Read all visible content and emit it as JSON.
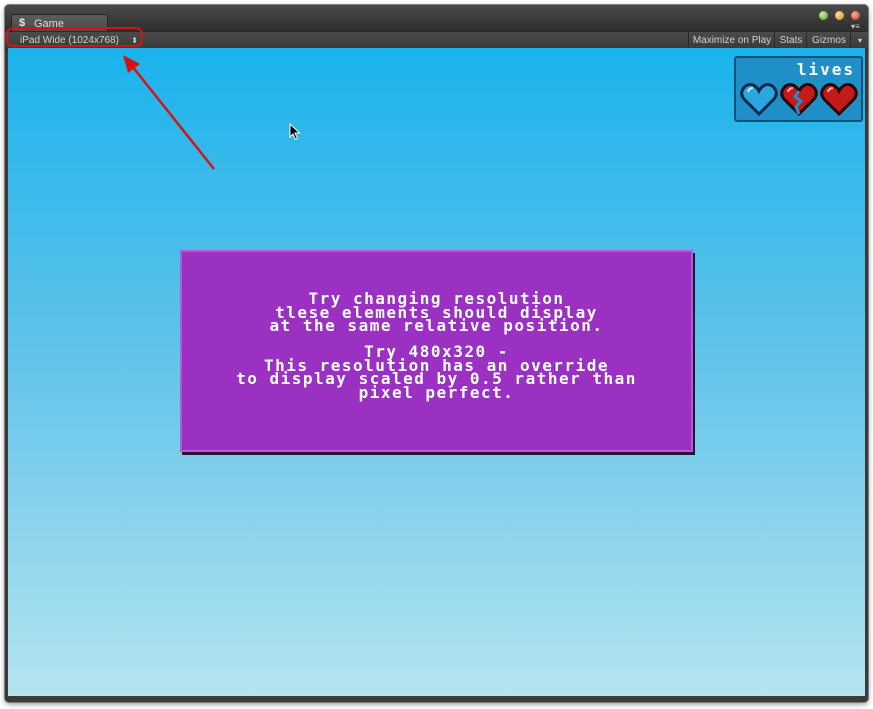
{
  "window": {
    "tab_title": "Game",
    "tab_icon": "unity-logo-icon",
    "traffic_lights": [
      "green",
      "orange",
      "red"
    ]
  },
  "toolbar": {
    "resolution_selected": "iPad Wide (1024x768)",
    "resolution_arrows": "⬍",
    "maximize_label": "Maximize on Play",
    "stats_label": "Stats",
    "gizmos_label": "Gizmos",
    "gizmos_arrow": "▾"
  },
  "game": {
    "lives": {
      "label": "lives",
      "hearts": [
        "empty",
        "broken",
        "full"
      ]
    },
    "message": {
      "block1": [
        "Try changing resolution",
        "tlese elements should display",
        "at the same relative position."
      ],
      "block2": [
        "Try 480x320 -",
        "This resolution has an override",
        "to display scaled by 0.5 rather than",
        "pixel perfect."
      ]
    }
  },
  "annotation": {
    "color": "#d41414"
  },
  "colors": {
    "sky_top": "#1ab3ec",
    "sky_bottom": "#b5e4f0",
    "panel_purple": "#9a31c2",
    "lives_panel": "#1f8fc8"
  }
}
